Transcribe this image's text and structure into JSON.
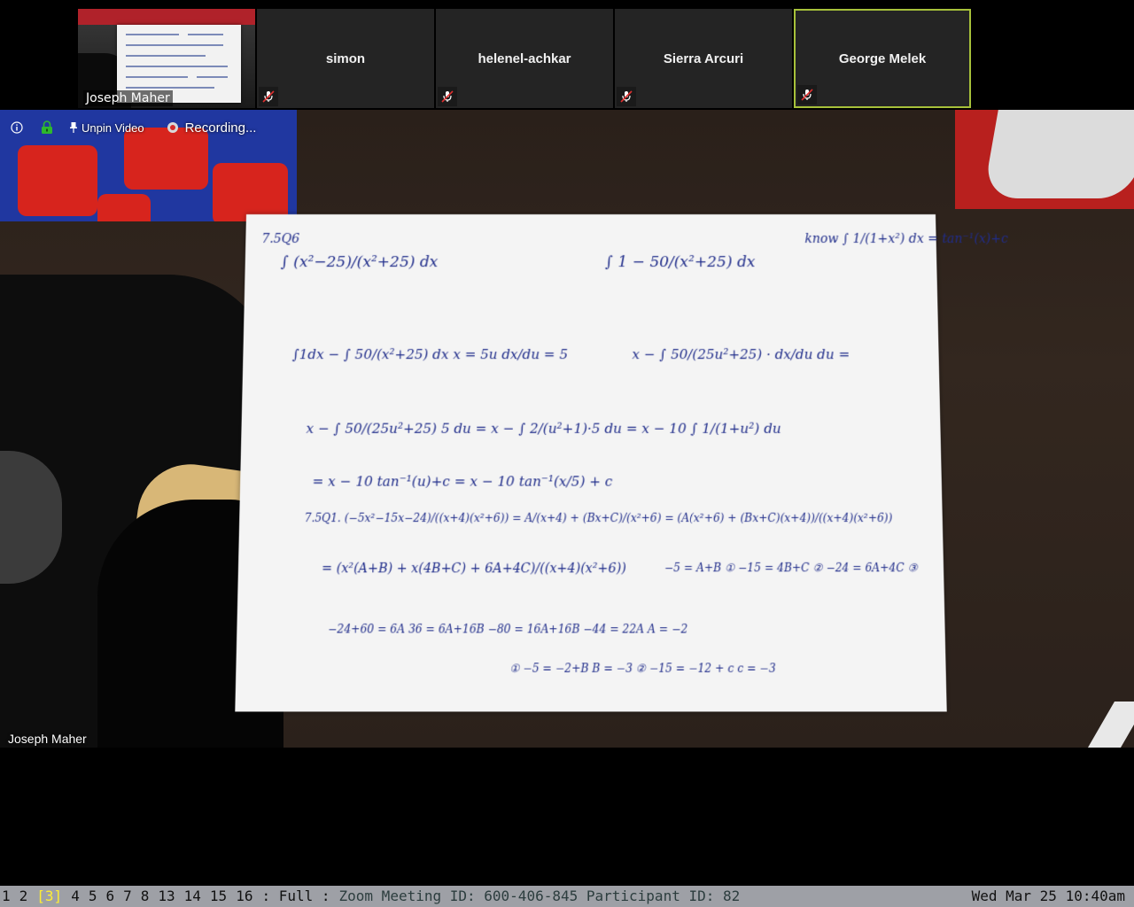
{
  "participants": {
    "self": {
      "name": "Joseph Maher"
    },
    "tiles": [
      {
        "name": "simon",
        "muted": true,
        "active": false
      },
      {
        "name": "helenel-achkar",
        "muted": true,
        "active": false
      },
      {
        "name": "Sierra Arcuri",
        "muted": true,
        "active": false
      },
      {
        "name": "George Melek",
        "muted": true,
        "active": true
      }
    ]
  },
  "video": {
    "pinned_name": "Joseph Maher",
    "toolbar": {
      "info_icon": "info-icon",
      "lock_icon": "lock-icon",
      "unpin_label": "Unpin Video",
      "recording_label": "Recording..."
    },
    "whiteboard": {
      "lines": [
        "7.5Q6",
        "∫ (x²−25)/(x²+25) dx",
        "∫ 1 − 50/(x²+25) dx",
        "know ∫ 1/(1+x²) dx = tan⁻¹(x)+c",
        "∫1dx − ∫ 50/(x²+25) dx    x = 5u   dx/du = 5",
        "x − ∫ 50/(25u²+25) · dx/du du =",
        "x − ∫ 50/(25u²+25) 5 du = x − ∫ 2/(u²+1)·5 du = x − 10 ∫ 1/(1+u²) du",
        "= x − 10 tan⁻¹(u)+c = x − 10 tan⁻¹(x/5) + c",
        "7.5Q1.  (−5x²−15x−24)/((x+4)(x²+6)) = A/(x+4) + (Bx+C)/(x²+6) = (A(x²+6) + (Bx+C)(x+4))/((x+4)(x²+6))",
        "= (x²(A+B) + x(4B+C) + 6A+4C)/((x+4)(x²+6))",
        "−5 = A+B ①   −15 = 4B+C ②   −24 = 6A+4C ③",
        "−24+60 = 6A   36 = 6A+16B   −80 = 16A+16B   −44 = 22A   A = −2",
        "① −5 = −2+B   B = −3     ② −15 = −12 + c   c = −3"
      ]
    }
  },
  "statusbar": {
    "workspaces": [
      "1",
      "2",
      "[3]",
      "4",
      "5",
      "6",
      "7",
      "8",
      "13",
      "14",
      "15",
      "16"
    ],
    "current_workspace": "[3]",
    "mode": ": Full :",
    "window_title": "Zoom Meeting ID: 600-406-845 Participant ID: 82",
    "clock": "Wed Mar 25 10:40am"
  },
  "colors": {
    "active_border": "#a7c13a",
    "statusbar_bg": "#9ea0a6",
    "current_workspace": "#ffee33",
    "ink": "#1f2c8a"
  }
}
